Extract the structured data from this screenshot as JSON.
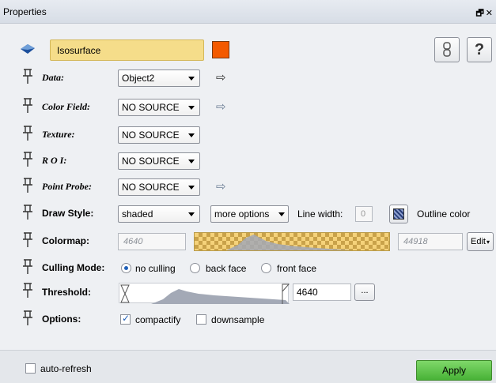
{
  "window": {
    "title": "Properties",
    "float_icon": "float-icon",
    "close_icon": "close-icon"
  },
  "header": {
    "name_value": "Isosurface",
    "accent_color": "#f35a00",
    "help_label": "?"
  },
  "rows": {
    "data": {
      "label": "Data:",
      "value": "Object2"
    },
    "color_field": {
      "label": "Color Field:",
      "value": "NO SOURCE"
    },
    "texture": {
      "label": "Texture:",
      "value": "NO SOURCE"
    },
    "roi": {
      "label": "R O I:",
      "value": "NO SOURCE"
    },
    "point_probe": {
      "label": "Point Probe:",
      "value": "NO SOURCE"
    },
    "draw_style": {
      "label": "Draw Style:",
      "value": "shaded",
      "more_options": "more options",
      "line_width_label": "Line width:",
      "line_width_value": "0",
      "outline_label": "Outline color"
    },
    "colormap": {
      "label": "Colormap:",
      "min": "4640",
      "max": "44918",
      "edit_label": "Edit"
    },
    "culling": {
      "label": "Culling Mode:",
      "options": [
        "no culling",
        "back face",
        "front face"
      ],
      "selected": "no culling"
    },
    "threshold": {
      "label": "Threshold:",
      "value": "4640",
      "more_label": "..."
    },
    "options": {
      "label": "Options:",
      "compactify": "compactify",
      "compactify_checked": true,
      "downsample": "downsample",
      "downsample_checked": false
    }
  },
  "footer": {
    "auto_refresh": "auto-refresh",
    "auto_refresh_checked": false,
    "apply": "Apply"
  }
}
